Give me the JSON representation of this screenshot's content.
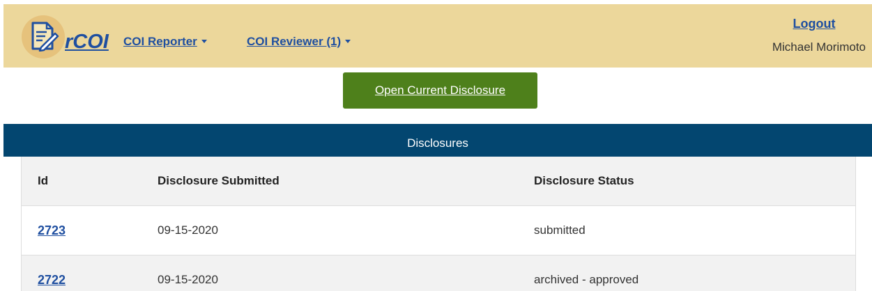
{
  "navbar": {
    "logo_text": "rCOI",
    "menu": [
      {
        "label": "COI Reporter"
      },
      {
        "label": "COI Reviewer (1)"
      }
    ],
    "logout_label": "Logout",
    "user_name": "Michael Morimoto"
  },
  "main": {
    "open_button_label": "Open Current Disclosure",
    "table_title": "Disclosures",
    "columns": [
      "Id",
      "Disclosure Submitted",
      "Disclosure Status"
    ],
    "rows": [
      {
        "id": "2723",
        "submitted": "09-15-2020",
        "status": "submitted"
      },
      {
        "id": "2722",
        "submitted": "09-15-2020",
        "status": "archived - approved"
      }
    ]
  },
  "colors": {
    "navbar_bg": "#ecd79b",
    "link_blue": "#1f4fa0",
    "button_green": "#4e801b",
    "table_header_bg": "#034670"
  },
  "icons": {
    "logo": "document-pen-icon",
    "dropdown": "caret-down-icon"
  }
}
